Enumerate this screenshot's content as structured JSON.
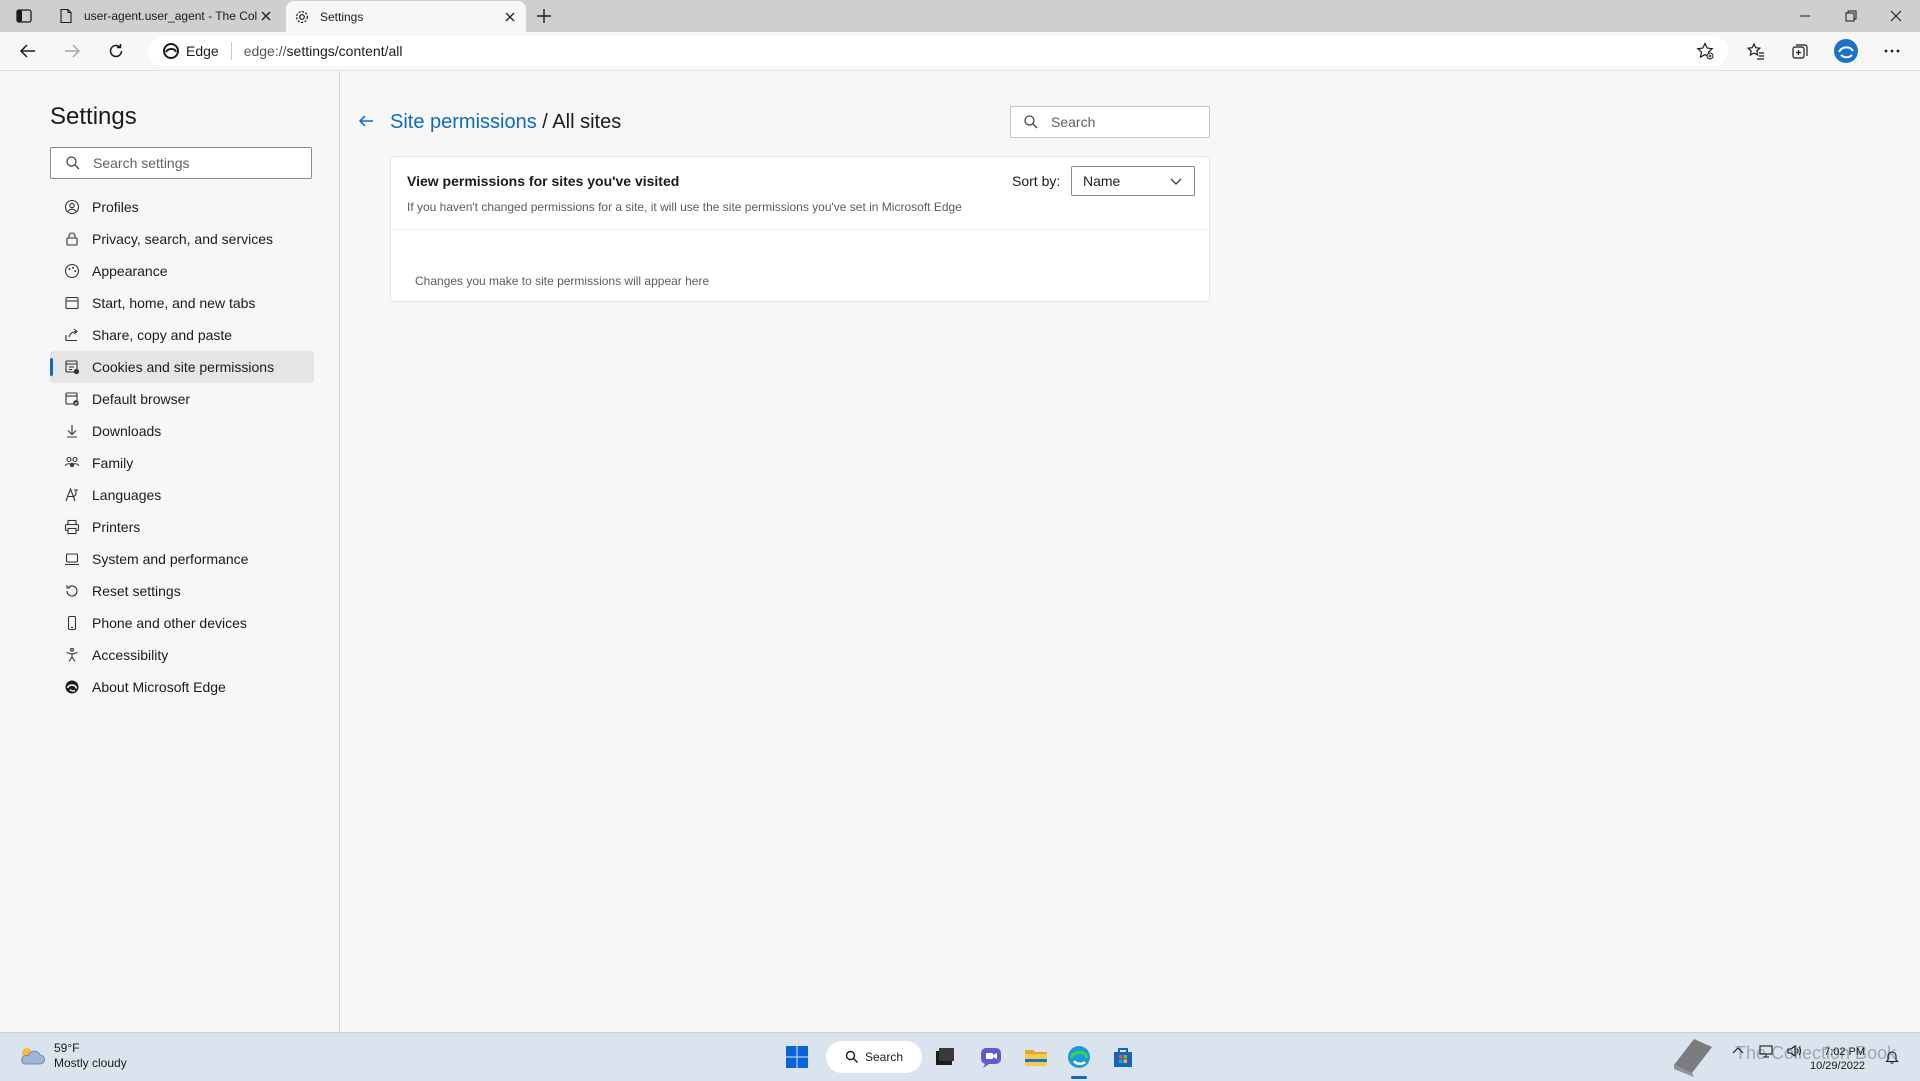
{
  "browser": {
    "tabs": [
      {
        "title": "user-agent.user_agent - The Coll"
      },
      {
        "title": "Settings"
      }
    ],
    "address": {
      "site_label": "Edge",
      "url_scheme": "edge://",
      "url_path": "settings/content/all"
    }
  },
  "sidebar": {
    "title": "Settings",
    "search_placeholder": "Search settings",
    "items": [
      {
        "label": "Profiles",
        "icon": "profile-icon"
      },
      {
        "label": "Privacy, search, and services",
        "icon": "lock-icon"
      },
      {
        "label": "Appearance",
        "icon": "appearance-icon"
      },
      {
        "label": "Start, home, and new tabs",
        "icon": "home-tabs-icon"
      },
      {
        "label": "Share, copy and paste",
        "icon": "share-icon"
      },
      {
        "label": "Cookies and site permissions",
        "icon": "cookies-icon",
        "active": true
      },
      {
        "label": "Default browser",
        "icon": "browser-icon"
      },
      {
        "label": "Downloads",
        "icon": "download-icon"
      },
      {
        "label": "Family",
        "icon": "family-icon"
      },
      {
        "label": "Languages",
        "icon": "language-icon"
      },
      {
        "label": "Printers",
        "icon": "printer-icon"
      },
      {
        "label": "System and performance",
        "icon": "laptop-icon"
      },
      {
        "label": "Reset settings",
        "icon": "reset-icon"
      },
      {
        "label": "Phone and other devices",
        "icon": "phone-icon"
      },
      {
        "label": "Accessibility",
        "icon": "accessibility-icon"
      },
      {
        "label": "About Microsoft Edge",
        "icon": "edge-logo-icon"
      }
    ]
  },
  "main": {
    "breadcrumb_link": "Site permissions",
    "breadcrumb_separator": " / ",
    "breadcrumb_current": "All sites",
    "search_placeholder": "Search",
    "card": {
      "title": "View permissions for sites you've visited",
      "description": "If you haven't changed permissions for a site, it will use the site permissions you've set in Microsoft Edge",
      "sort_label": "Sort by:",
      "sort_value": "Name",
      "empty_message": "Changes you make to site permissions will appear here"
    }
  },
  "taskbar": {
    "weather_temp": "59°F",
    "weather_desc": "Mostly cloudy",
    "search_label": "Search",
    "time": "7:02 PM",
    "date": "10/29/2022",
    "watermark": "The Collection Book"
  },
  "colors": {
    "accent": "#0f6cbd",
    "taskbar": "#dbe3ee"
  }
}
